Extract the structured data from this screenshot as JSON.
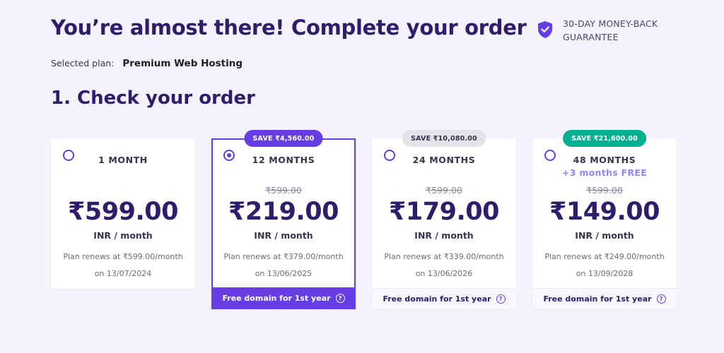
{
  "header": {
    "title": "You’re almost there! Complete your order",
    "guarantee": "30-DAY MONEY-BACK GUARANTEE",
    "guarantee_icon": "shield-check-icon"
  },
  "selected_plan": {
    "label": "Selected plan:",
    "name": "Premium Web Hosting"
  },
  "section": {
    "title": "1. Check your order"
  },
  "colors": {
    "primary": "#673de6",
    "heading": "#2f1c6a",
    "save_green": "#00b090",
    "save_gray": "#e3e3ea",
    "background": "#f4f2fc"
  },
  "plans": [
    {
      "period": "1 MONTH",
      "price": "₹599.00",
      "unit": "INR / month",
      "renew_line1": "Plan renews at ₹599.00/month",
      "renew_line2": "on 13/07/2024",
      "selected": false
    },
    {
      "period": "12 MONTHS",
      "badge": "SAVE ₹4,560.00",
      "old_price": "₹599.00",
      "price": "₹219.00",
      "unit": "INR / month",
      "renew_line1": "Plan renews at ₹379.00/month",
      "renew_line2": "on 13/06/2025",
      "footer": "Free domain for 1st year",
      "selected": true
    },
    {
      "period": "24 MONTHS",
      "badge": "SAVE ₹10,080.00",
      "old_price": "₹599.00",
      "price": "₹179.00",
      "unit": "INR / month",
      "renew_line1": "Plan renews at ₹339.00/month",
      "renew_line2": "on 13/06/2026",
      "footer": "Free domain for 1st year",
      "selected": false
    },
    {
      "period": "48 MONTHS",
      "bonus": "+3 months FREE",
      "badge": "SAVE ₹21,600.00",
      "old_price": "₹599.00",
      "price": "₹149.00",
      "unit": "INR / month",
      "renew_line1": "Plan renews at ₹249.00/month",
      "renew_line2": "on 13/09/2028",
      "footer": "Free domain for 1st year",
      "selected": false
    }
  ],
  "help_icon_glyph": "?"
}
